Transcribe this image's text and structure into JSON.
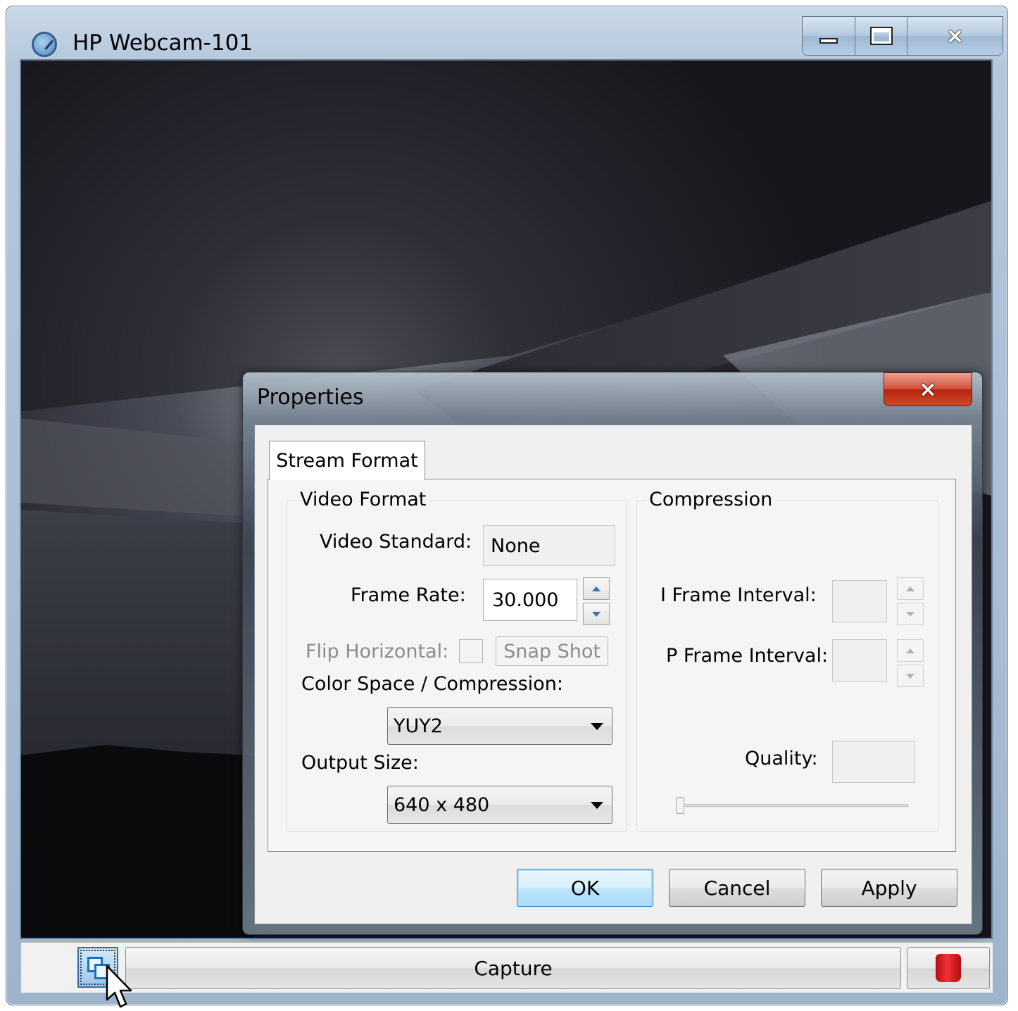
{
  "window": {
    "title": "HP Webcam-101",
    "icon": "webcam-app-icon",
    "controls": {
      "minimize": "minimize-icon",
      "maximize": "maximize-icon",
      "close": "×"
    }
  },
  "bottom_bar": {
    "capture_label": "Capture",
    "pip_icon": "picture-in-picture-icon",
    "stop_icon": "stop-record-icon"
  },
  "dialog": {
    "title": "Properties",
    "close": "×",
    "tabs": [
      {
        "label": "Stream Format",
        "active": true
      }
    ],
    "video_format": {
      "group_label": "Video Format",
      "video_standard_label": "Video Standard:",
      "video_standard_value": "None",
      "frame_rate_label": "Frame Rate:",
      "frame_rate_value": "30.000",
      "flip_horizontal_label": "Flip Horizontal:",
      "flip_horizontal_checked": false,
      "snap_shot_label": "Snap Shot",
      "color_space_label": "Color Space / Compression:",
      "color_space_value": "YUY2",
      "output_size_label": "Output Size:",
      "output_size_value": "640 x 480"
    },
    "compression": {
      "group_label": "Compression",
      "i_frame_label": "I Frame Interval:",
      "i_frame_value": "",
      "p_frame_label": "P Frame Interval:",
      "p_frame_value": "",
      "quality_label": "Quality:",
      "quality_value": "",
      "quality_slider": 0
    },
    "buttons": {
      "ok": "OK",
      "cancel": "Cancel",
      "apply": "Apply"
    }
  },
  "colors": {
    "title_bar": "#b4c7dc",
    "dialog_close": "#c9371f",
    "ok_focus": "#3c7fb1",
    "video_bg": "#111118"
  }
}
